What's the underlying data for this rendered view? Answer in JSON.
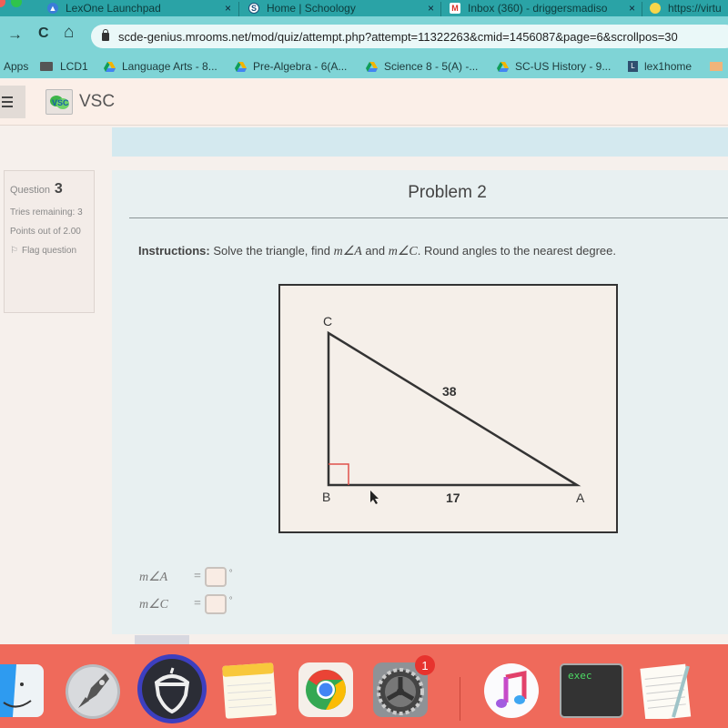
{
  "browser": {
    "tabs": [
      {
        "title": "LexOne Launchpad",
        "icon": "drive-like-icon"
      },
      {
        "title": "Home | Schoology",
        "icon": "schoology-icon"
      },
      {
        "title": "Inbox (360) - driggersmadiso",
        "icon": "gmail-icon"
      },
      {
        "title": "https://virtu",
        "icon": "lightbulb-icon"
      }
    ],
    "close_glyph": "×",
    "nav": {
      "forward": "→",
      "reload": "C",
      "home": "⌂"
    },
    "url": "scde-genius.mrooms.net/mod/quiz/attempt.php?attempt=11322263&cmid=1456087&page=6&scrollpos=30",
    "bookmarks": [
      {
        "label": "Apps",
        "icon": "apps-icon"
      },
      {
        "label": "LCD1",
        "icon": "folder-icon"
      },
      {
        "label": "Language Arts - 8...",
        "icon": "google-drive-icon"
      },
      {
        "label": "Pre-Algebra - 6(A...",
        "icon": "google-drive-icon"
      },
      {
        "label": "Science 8 - 5(A) -...",
        "icon": "google-drive-icon"
      },
      {
        "label": "SC-US History - 9...",
        "icon": "google-drive-icon"
      },
      {
        "label": "lex1home",
        "icon": "lex-icon"
      }
    ]
  },
  "app": {
    "brand": "VSC"
  },
  "question_info": {
    "label": "Question",
    "number": "3",
    "tries": "Tries remaining: 3",
    "points": "Points out of 2.00",
    "flag": "Flag question"
  },
  "problem": {
    "title": "Problem 2",
    "instructions_label": "Instructions:",
    "instructions_pre": " Solve the triangle, find ",
    "angle_a": "m∠A",
    "and": " and ",
    "angle_c": "m∠C",
    "instructions_post": ". Round angles to the nearest degree."
  },
  "figure": {
    "vertices": {
      "A": "A",
      "B": "B",
      "C": "C"
    },
    "hypotenuse_label": "38",
    "base_label": "17",
    "right_angle_at": "B",
    "right_angle_color": "#e0504a"
  },
  "answers": [
    {
      "label": "m∠A",
      "equals": "=",
      "value": "",
      "unit": "°"
    },
    {
      "label": "m∠C",
      "equals": "=",
      "value": "",
      "unit": "°"
    }
  ],
  "dock": {
    "items": [
      "Finder",
      "Launchpad",
      "Socratic",
      "Notes",
      "Google Chrome",
      "System Preferences",
      "iTunes",
      "Terminal exec",
      "TextEdit"
    ],
    "system_prefs_badge": "1",
    "terminal_text": "exec"
  }
}
